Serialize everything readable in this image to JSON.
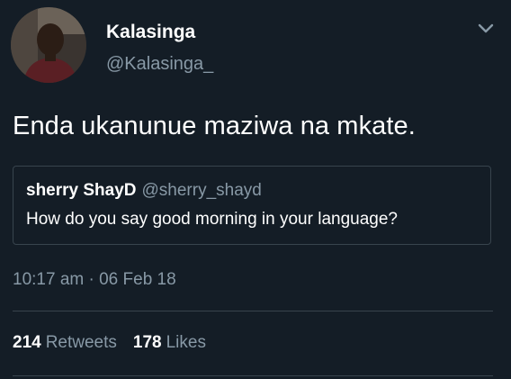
{
  "author": {
    "display_name": "Kalasinga",
    "handle": "@Kalasinga_"
  },
  "tweet": {
    "text": "Enda ukanunue maziwa na mkate."
  },
  "quoted_tweet": {
    "display_name": "sherry ShayD",
    "handle": "@sherry_shayd",
    "text": "How do you say good morning in your language?"
  },
  "meta": {
    "timestamp": "10:17 am · 06 Feb 18"
  },
  "stats": {
    "retweets_count": "214",
    "retweets_label": "Retweets",
    "likes_count": "178",
    "likes_label": "Likes"
  },
  "colors": {
    "background": "#141d26",
    "primary_text": "#ffffff",
    "secondary_text": "#8899a6",
    "border": "#38444d"
  },
  "icons": {
    "menu": "chevron-down-icon",
    "avatar": "user-avatar"
  }
}
